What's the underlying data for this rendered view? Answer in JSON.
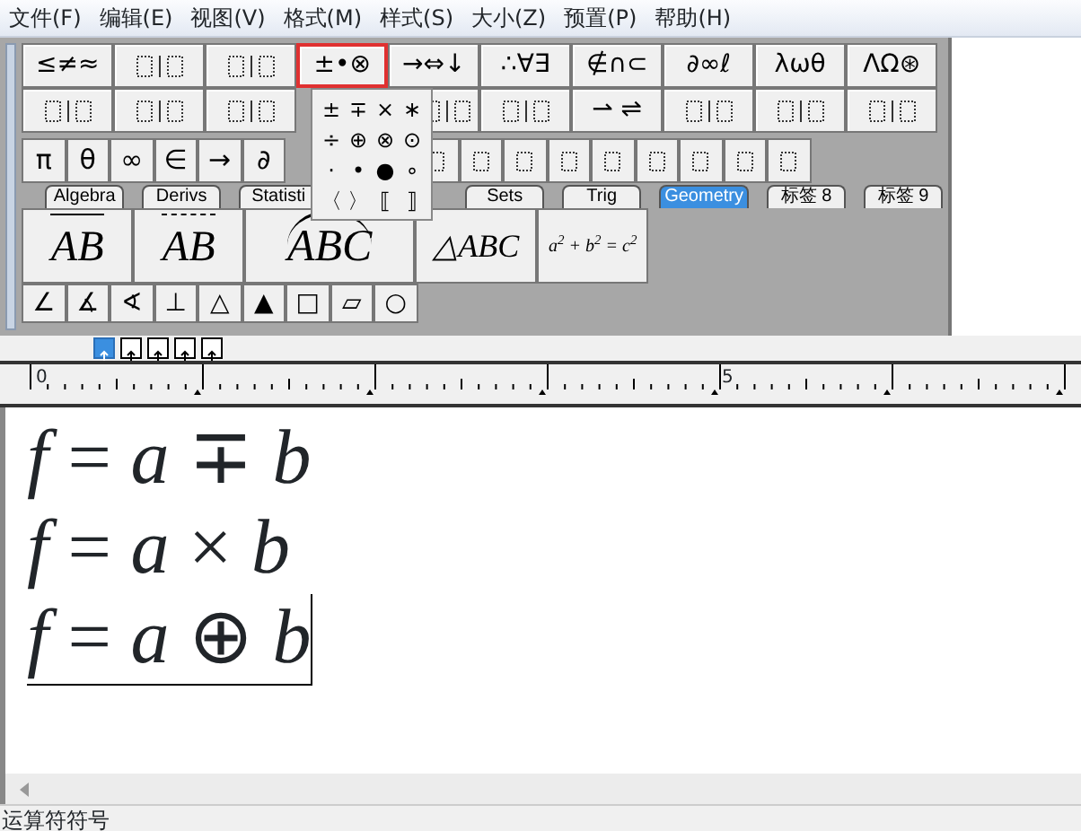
{
  "menu": [
    "文件(F)",
    "编辑(E)",
    "视图(V)",
    "格式(M)",
    "样式(S)",
    "大小(Z)",
    "预置(P)",
    "帮助(H)"
  ],
  "palette_rows": [
    [
      {
        "kind": "symbols",
        "label": "≤≠≈",
        "selected": false
      },
      {
        "kind": "template",
        "selected": false
      },
      {
        "kind": "template",
        "selected": false
      },
      {
        "kind": "symbols",
        "label": "±•⊗",
        "selected": true
      },
      {
        "kind": "symbols",
        "label": "→⇔↓",
        "selected": false
      },
      {
        "kind": "symbols",
        "label": "∴∀∃",
        "selected": false
      },
      {
        "kind": "symbols",
        "label": "∉∩⊂",
        "selected": false
      },
      {
        "kind": "symbols",
        "label": "∂∞ℓ",
        "selected": false
      },
      {
        "kind": "symbols",
        "label": "λωθ",
        "selected": false
      },
      {
        "kind": "symbols",
        "label": "ΛΩ⊛",
        "selected": false
      }
    ],
    [
      {
        "kind": "template",
        "selected": false
      },
      {
        "kind": "template",
        "selected": false
      },
      {
        "kind": "template",
        "selected": false
      },
      {
        "kind": "covered"
      },
      {
        "kind": "template",
        "selected": false
      },
      {
        "kind": "template",
        "selected": false
      },
      {
        "kind": "symbols",
        "label": "⇀ ⇌",
        "selected": false
      },
      {
        "kind": "template",
        "selected": false
      },
      {
        "kind": "template",
        "selected": false
      },
      {
        "kind": "template",
        "selected": false
      }
    ]
  ],
  "small_row": [
    {
      "kind": "symbols",
      "label": "π"
    },
    {
      "kind": "symbols",
      "label": "θ"
    },
    {
      "kind": "symbols",
      "label": "∞"
    },
    {
      "kind": "symbols",
      "label": "∈"
    },
    {
      "kind": "symbols",
      "label": "→"
    },
    {
      "kind": "symbols",
      "label": "∂"
    },
    {
      "kind": "covered"
    },
    {
      "kind": "template"
    },
    {
      "kind": "template"
    },
    {
      "kind": "template"
    },
    {
      "kind": "template"
    },
    {
      "kind": "template"
    },
    {
      "kind": "template"
    },
    {
      "kind": "template"
    },
    {
      "kind": "template"
    },
    {
      "kind": "template"
    }
  ],
  "tabs": [
    {
      "label": "Algebra",
      "selected": false
    },
    {
      "label": "Derivs",
      "selected": false
    },
    {
      "label": "Statisti",
      "selected": false
    },
    {
      "kind": "covered"
    },
    {
      "label": "Sets",
      "selected": false
    },
    {
      "label": "Trig",
      "selected": false
    },
    {
      "label": "Geometry",
      "selected": true
    },
    {
      "label": "标签 8",
      "selected": false
    },
    {
      "label": "标签 9",
      "selected": false
    }
  ],
  "geometry_templates": [
    {
      "kind": "arrow",
      "label": "AB"
    },
    {
      "kind": "double-arrow",
      "label": "AB"
    },
    {
      "kind": "arc",
      "label": "ABC"
    },
    {
      "kind": "plain",
      "label": "△*ABC*"
    },
    {
      "kind": "small",
      "label": "*a*$^{2}$ + *b*$^{2}$ = *c*$^{2}$"
    }
  ],
  "geometry_symbols": [
    "∠",
    "∡",
    "∢",
    "⊥",
    "△",
    "▲",
    "□",
    "▱",
    "○"
  ],
  "popup": [
    [
      "±",
      "∓",
      "×",
      "∗"
    ],
    [
      "÷",
      "⊕",
      "⊗",
      "⊙"
    ],
    [
      "·",
      "•",
      "●",
      "∘"
    ],
    [
      "〈",
      "〉",
      "⟦",
      "⟧"
    ]
  ],
  "nudge": [
    {
      "selected": true
    },
    {
      "selected": false
    },
    {
      "selected": false
    },
    {
      "selected": false
    },
    {
      "selected": false
    }
  ],
  "ruler": [
    "0",
    "5"
  ],
  "equations": [
    {
      "text": "*f* = *a* ∓ *b*",
      "selected": false
    },
    {
      "text": "*f* = *a* × *b*",
      "selected": false
    },
    {
      "text": "*f* = *a* ⊕ *b*",
      "selected": true
    }
  ],
  "status": "运算符符号"
}
